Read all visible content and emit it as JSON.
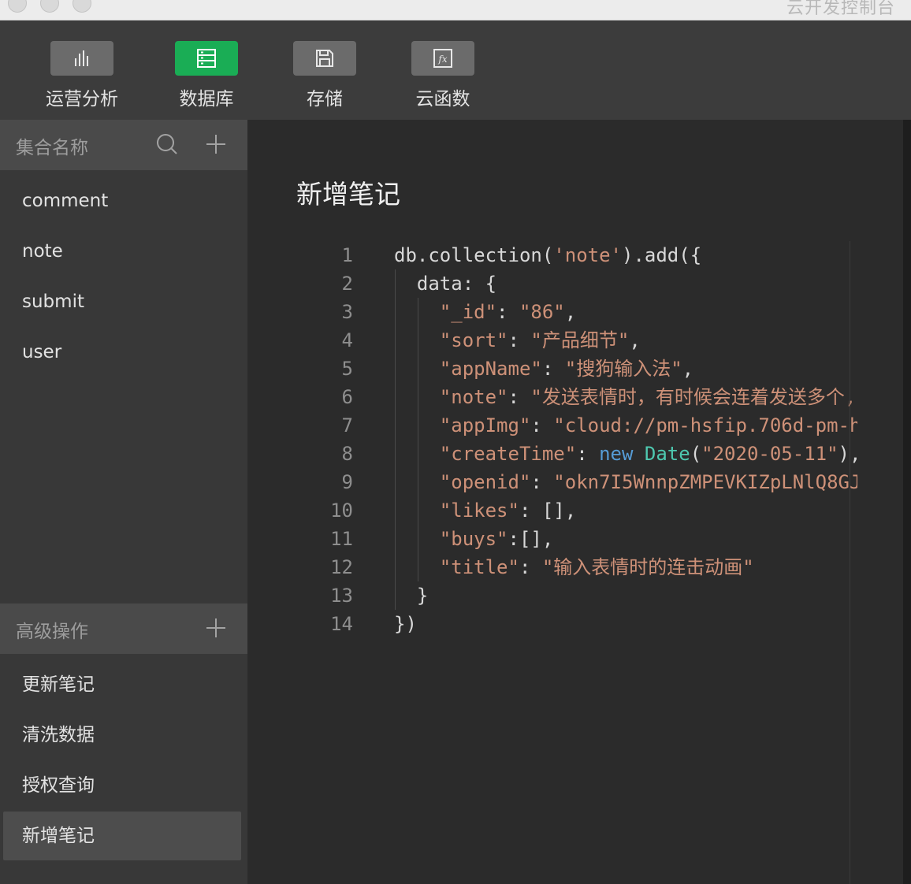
{
  "window": {
    "title": "云开发控制台"
  },
  "toolbar": {
    "items": [
      {
        "label": "运营分析",
        "icon": "bar-chart-icon"
      },
      {
        "label": "数据库",
        "icon": "database-icon"
      },
      {
        "label": "存储",
        "icon": "save-icon"
      },
      {
        "label": "云函数",
        "icon": "function-icon"
      }
    ],
    "active": "数据库"
  },
  "sidebar": {
    "collections_header": "集合名称",
    "collections": [
      "comment",
      "note",
      "submit",
      "user"
    ],
    "advanced_header": "高级操作",
    "advanced_items": [
      "更新笔记",
      "清洗数据",
      "授权查询",
      "新增笔记"
    ],
    "selected": "新增笔记"
  },
  "main": {
    "title": "新增笔记",
    "code": {
      "line_numbers": [
        "1",
        "2",
        "3",
        "4",
        "5",
        "6",
        "7",
        "8",
        "9",
        "10",
        "11",
        "12",
        "13",
        "14"
      ],
      "lines": [
        [
          {
            "t": "db.collection(",
            "c": "k"
          },
          {
            "t": "'note'",
            "c": "s"
          },
          {
            "t": ").add({",
            "c": "k"
          }
        ],
        [
          {
            "t": "  data: {",
            "c": "k"
          }
        ],
        [
          {
            "t": "    ",
            "c": "k"
          },
          {
            "t": "\"_id\"",
            "c": "s"
          },
          {
            "t": ": ",
            "c": "k"
          },
          {
            "t": "\"86\"",
            "c": "s"
          },
          {
            "t": ",",
            "c": "k"
          }
        ],
        [
          {
            "t": "    ",
            "c": "k"
          },
          {
            "t": "\"sort\"",
            "c": "s"
          },
          {
            "t": ": ",
            "c": "k"
          },
          {
            "t": "\"产品细节\"",
            "c": "s"
          },
          {
            "t": ",",
            "c": "k"
          }
        ],
        [
          {
            "t": "    ",
            "c": "k"
          },
          {
            "t": "\"appName\"",
            "c": "s"
          },
          {
            "t": ": ",
            "c": "k"
          },
          {
            "t": "\"搜狗输入法\"",
            "c": "s"
          },
          {
            "t": ",",
            "c": "k"
          }
        ],
        [
          {
            "t": "    ",
            "c": "k"
          },
          {
            "t": "\"note\"",
            "c": "s"
          },
          {
            "t": ": ",
            "c": "k"
          },
          {
            "t": "\"发送表情时，有时候会连着发送多个,",
            "c": "s"
          }
        ],
        [
          {
            "t": "    ",
            "c": "k"
          },
          {
            "t": "\"appImg\"",
            "c": "s"
          },
          {
            "t": ": ",
            "c": "k"
          },
          {
            "t": "\"cloud://pm-hsfip.706d-pm-h",
            "c": "s"
          }
        ],
        [
          {
            "t": "    ",
            "c": "k"
          },
          {
            "t": "\"createTime\"",
            "c": "s"
          },
          {
            "t": ": ",
            "c": "k"
          },
          {
            "t": "new",
            "c": "kw"
          },
          {
            "t": " ",
            "c": "k"
          },
          {
            "t": "Date",
            "c": "cls"
          },
          {
            "t": "(",
            "c": "k"
          },
          {
            "t": "\"2020-05-11\"",
            "c": "s"
          },
          {
            "t": "),",
            "c": "k"
          }
        ],
        [
          {
            "t": "    ",
            "c": "k"
          },
          {
            "t": "\"openid\"",
            "c": "s"
          },
          {
            "t": ": ",
            "c": "k"
          },
          {
            "t": "\"okn7I5WnnpZMPEVKIZpLNlQ8GJ",
            "c": "s"
          }
        ],
        [
          {
            "t": "    ",
            "c": "k"
          },
          {
            "t": "\"likes\"",
            "c": "s"
          },
          {
            "t": ": [],",
            "c": "k"
          }
        ],
        [
          {
            "t": "    ",
            "c": "k"
          },
          {
            "t": "\"buys\"",
            "c": "s"
          },
          {
            "t": ":[],",
            "c": "k"
          }
        ],
        [
          {
            "t": "    ",
            "c": "k"
          },
          {
            "t": "\"title\"",
            "c": "s"
          },
          {
            "t": ": ",
            "c": "k"
          },
          {
            "t": "\"输入表情时的连击动画\"",
            "c": "s"
          }
        ],
        [
          {
            "t": "  }",
            "c": "k"
          }
        ],
        [
          {
            "t": "})",
            "c": "k"
          }
        ]
      ]
    }
  },
  "colors": {
    "accent": "#1aad55",
    "string": "#ce9178",
    "keyword": "#569cd6",
    "class": "#4ec9b0"
  }
}
